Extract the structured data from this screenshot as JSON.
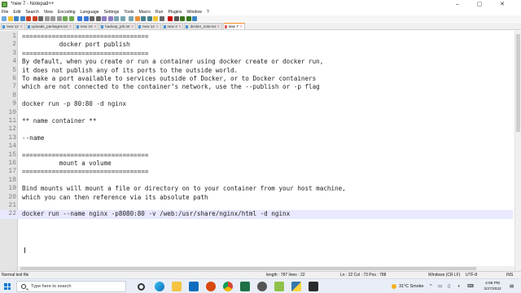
{
  "window": {
    "title": "*new 7 - Notepad++",
    "controls": [
      "–",
      "▢",
      "✕"
    ]
  },
  "menu": [
    "File",
    "Edit",
    "Search",
    "View",
    "Encoding",
    "Language",
    "Settings",
    "Tools",
    "Macro",
    "Run",
    "Plugins",
    "Window",
    "?"
  ],
  "toolbar_icons": [
    "new-file-icon",
    "open-file-icon",
    "save-icon",
    "save-all-icon",
    "close-icon",
    "close-all-icon",
    "print-icon",
    "cut-icon",
    "copy-icon",
    "paste-icon",
    "undo-icon",
    "redo-icon",
    "find-icon",
    "replace-icon",
    "zoom-in-icon",
    "zoom-out-icon",
    "sync-v-icon",
    "sync-h-icon",
    "word-wrap-icon",
    "all-chars-icon",
    "indent-guide-icon",
    "lang-icon",
    "doc-map-icon",
    "function-list-icon",
    "folder-icon",
    "monitor-icon",
    "record-icon",
    "stop-icon",
    "play-icon",
    "play-multi-icon",
    "save-macro-icon"
  ],
  "tabs": [
    {
      "label": "new 12",
      "active": false
    },
    {
      "label": "uploads_packages.txt",
      "active": false
    },
    {
      "label": "new 10",
      "active": false
    },
    {
      "label": "hadoop_job.txt",
      "active": false
    },
    {
      "label": "new 14",
      "active": false
    },
    {
      "label": "new 2",
      "active": false
    },
    {
      "label": "docker_note.txt",
      "active": false
    },
    {
      "label": "new 7",
      "active": true
    }
  ],
  "editor": {
    "lines": [
      {
        "n": "1",
        "text": "=================================="
      },
      {
        "n": "2",
        "text": "          docker port publish"
      },
      {
        "n": "3",
        "text": "=================================="
      },
      {
        "n": "4",
        "text": "By default, when you create or run a container using docker create or docker run,"
      },
      {
        "n": "5",
        "text": "it does not publish any of its ports to the outside world."
      },
      {
        "n": "6",
        "text": "To make a port available to services outside of Docker, or to Docker containers"
      },
      {
        "n": "7",
        "text": "which are not connected to the container’s network, use the --publish or -p flag"
      },
      {
        "n": "8",
        "text": ""
      },
      {
        "n": "9",
        "text": "docker run -p 80:80 -d nginx"
      },
      {
        "n": "10",
        "text": ""
      },
      {
        "n": "11",
        "text": "** name container **"
      },
      {
        "n": "12",
        "text": ""
      },
      {
        "n": "13",
        "text": "--name"
      },
      {
        "n": "14",
        "text": ""
      },
      {
        "n": "15",
        "text": "=================================="
      },
      {
        "n": "16",
        "text": "          mount a volume"
      },
      {
        "n": "17",
        "text": "=================================="
      },
      {
        "n": "18",
        "text": ""
      },
      {
        "n": "19",
        "text": "Bind mounts will mount a file or directory on to your container from your host machine,"
      },
      {
        "n": "20",
        "text": "which you can then reference via its absolute path"
      },
      {
        "n": "21",
        "text": ""
      },
      {
        "n": "22",
        "text": "docker run --name nginx -p8080:80 -v /web:/usr/share/nginx/html -d nginx"
      }
    ],
    "current_line": 22
  },
  "status": {
    "file_type": "Normal text file",
    "length": "length : 787   lines : 22",
    "position": "Ln : 22   Col : 73   Pos : 788",
    "eol": "Windows (CR LF)",
    "encoding": "UTF-8",
    "mode": "INS"
  },
  "taskbar": {
    "search_placeholder": "Type here to search",
    "apps": [
      "task-view-icon",
      "edge-icon",
      "file-explorer-icon",
      "mail-icon",
      "camera-icon",
      "chrome-icon",
      "spreadsheet-icon",
      "settings-icon",
      "notepadpp-icon",
      "python-icon",
      "terminal-icon"
    ],
    "weather": "31°C  Smoke",
    "time": "4:58 PM",
    "date": "3/27/2022"
  },
  "colors": {
    "gutter": "#e4e4e4",
    "current_line": "#e8e8ff",
    "active_tab_accent": "#f58a1f",
    "taskbar": "#e9eef6",
    "windows_blue": "#0078d4"
  }
}
